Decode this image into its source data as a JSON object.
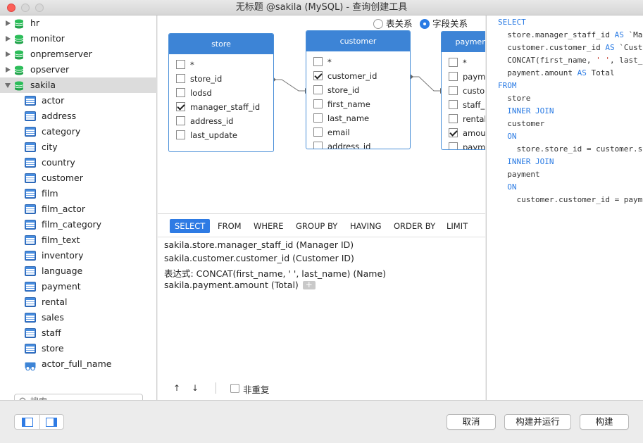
{
  "window": {
    "title": "无标题 @sakila (MySQL) - 查询创建工具"
  },
  "colors": {
    "accent": "#2e7be4",
    "table_header": "#3d84d6",
    "close": "#fc5f57",
    "db_icon": "#2dbd5a"
  },
  "sidebar": {
    "databases": [
      {
        "name": "hr",
        "expanded": false
      },
      {
        "name": "monitor",
        "expanded": false
      },
      {
        "name": "onpremserver",
        "expanded": false
      },
      {
        "name": "opserver",
        "expanded": false
      },
      {
        "name": "sakila",
        "expanded": true
      }
    ],
    "tables": [
      "actor",
      "address",
      "category",
      "city",
      "country",
      "customer",
      "film",
      "film_actor",
      "film_category",
      "film_text",
      "inventory",
      "language",
      "payment",
      "rental",
      "sales",
      "staff",
      "store"
    ],
    "views": [
      "actor_full_name"
    ],
    "search_placeholder": "搜索"
  },
  "canvas": {
    "mode_options": [
      {
        "label": "表关系",
        "selected": false
      },
      {
        "label": "字段关系",
        "selected": true
      }
    ],
    "tables": [
      {
        "name": "store",
        "fields": [
          {
            "name": "*",
            "checked": false
          },
          {
            "name": "store_id",
            "checked": false
          },
          {
            "name": "lodsd",
            "checked": false
          },
          {
            "name": "manager_staff_id",
            "checked": true
          },
          {
            "name": "address_id",
            "checked": false
          },
          {
            "name": "last_update",
            "checked": false
          }
        ]
      },
      {
        "name": "customer",
        "fields": [
          {
            "name": "*",
            "checked": false
          },
          {
            "name": "customer_id",
            "checked": true
          },
          {
            "name": "store_id",
            "checked": false
          },
          {
            "name": "first_name",
            "checked": false
          },
          {
            "name": "last_name",
            "checked": false
          },
          {
            "name": "email",
            "checked": false
          },
          {
            "name": "address_id",
            "checked": false
          }
        ]
      },
      {
        "name": "payment",
        "fields": [
          {
            "name": "*",
            "checked": false
          },
          {
            "name": "payment_id",
            "checked": false
          },
          {
            "name": "customer_id",
            "checked": false
          },
          {
            "name": "staff_id",
            "checked": false
          },
          {
            "name": "rental_id",
            "checked": false
          },
          {
            "name": "amount",
            "checked": true
          },
          {
            "name": "payment_date",
            "checked": false
          }
        ]
      }
    ]
  },
  "clause_tabs": [
    {
      "label": "SELECT",
      "active": true
    },
    {
      "label": "FROM",
      "active": false
    },
    {
      "label": "WHERE",
      "active": false
    },
    {
      "label": "GROUP BY",
      "active": false
    },
    {
      "label": "HAVING",
      "active": false
    },
    {
      "label": "ORDER BY",
      "active": false
    },
    {
      "label": "LIMIT",
      "active": false
    }
  ],
  "select_items": [
    "sakila.store.manager_staff_id   (Manager ID)",
    "sakila.customer.customer_id   (Customer ID)",
    "表达式:  CONCAT(first_name, ' ', last_name)   (Name)",
    "sakila.payment.amount   (Total)"
  ],
  "select_add_label": "+",
  "query_toolbar": {
    "move_up": "↑",
    "move_down": "↓",
    "distinct_label": "非重复",
    "distinct_checked": false
  },
  "sql_preview": {
    "lines": [
      "SELECT",
      "  store.manager_staff_id AS `Manager ID`,",
      "  customer.customer_id AS `Customer ID`,",
      "  CONCAT(first_name, ' ', last_name) AS `Name`,",
      "  payment.amount AS Total",
      "FROM",
      "  store",
      "  INNER JOIN",
      "  customer",
      "  ON",
      "    store.store_id = customer.store_id",
      "  INNER JOIN",
      "  payment",
      "  ON",
      "    customer.customer_id = payment.customer_id"
    ]
  },
  "footer": {
    "cancel": "取消",
    "build_run": "构建并运行",
    "build": "构建"
  }
}
